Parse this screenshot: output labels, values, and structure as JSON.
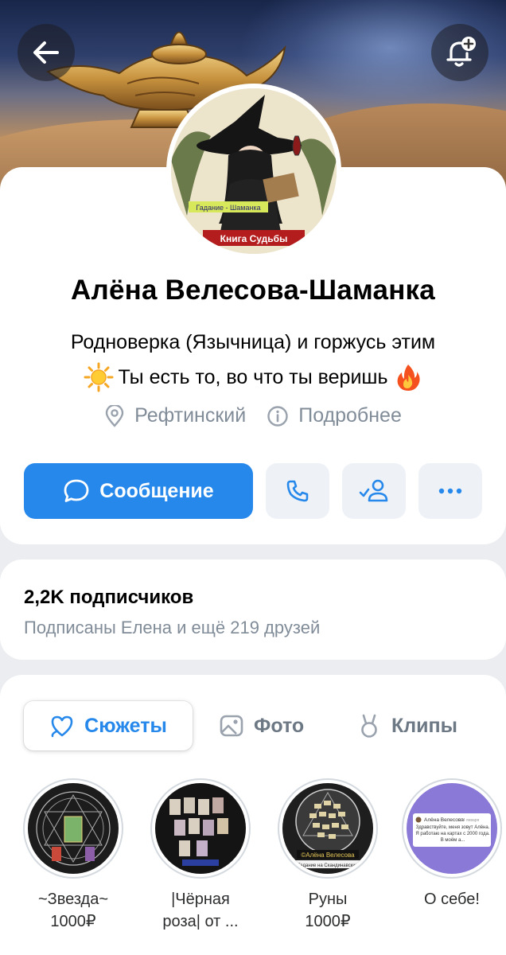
{
  "profile": {
    "name": "Алёна Велесова-Шаманка",
    "status_line1": "Родноверка (Язычница) и горжусь этим",
    "status_line2": "Ты есть то, во что ты веришь",
    "location": "Рефтинский",
    "details_label": "Подробнее",
    "avatar_caption_top": "Гадание - Шаманка",
    "avatar_caption_bottom": "Книга Судьбы"
  },
  "actions": {
    "message_label": "Сообщение",
    "call_icon": "phone-icon",
    "friend_icon": "user-check-icon",
    "more_icon": "more-dots-icon"
  },
  "followers": {
    "count_label": "2,2K подписчиков",
    "friends_label": "Подписаны Елена и ещё 219 друзей"
  },
  "tabs": [
    {
      "label": "Сюжеты",
      "icon": "stories-heart-icon",
      "active": true
    },
    {
      "label": "Фото",
      "icon": "photo-icon",
      "active": false
    },
    {
      "label": "Клипы",
      "icon": "clips-icon",
      "active": false
    }
  ],
  "stories": [
    {
      "line1": "~Звезда~",
      "line2": "1000₽"
    },
    {
      "line1": "|Чёрная",
      "line2": "роза| от ..."
    },
    {
      "line1": "Руны",
      "line2": "1000₽"
    },
    {
      "line1": "О себе!",
      "line2": ""
    }
  ],
  "story_thumb_text": {
    "rune_caption": "©Алёна Велесова",
    "rune_sub": "Гадание на Скандинавских",
    "about_author": "Алёна Велесова",
    "about_date": "14 января",
    "about_text": "Здравствуйте, меня зовут Алёна. Я работаю на картах с 2000 года. В моём а..."
  },
  "colors": {
    "accent": "#2688eb",
    "secondary_text": "#818c99",
    "background": "#ebedf0"
  }
}
